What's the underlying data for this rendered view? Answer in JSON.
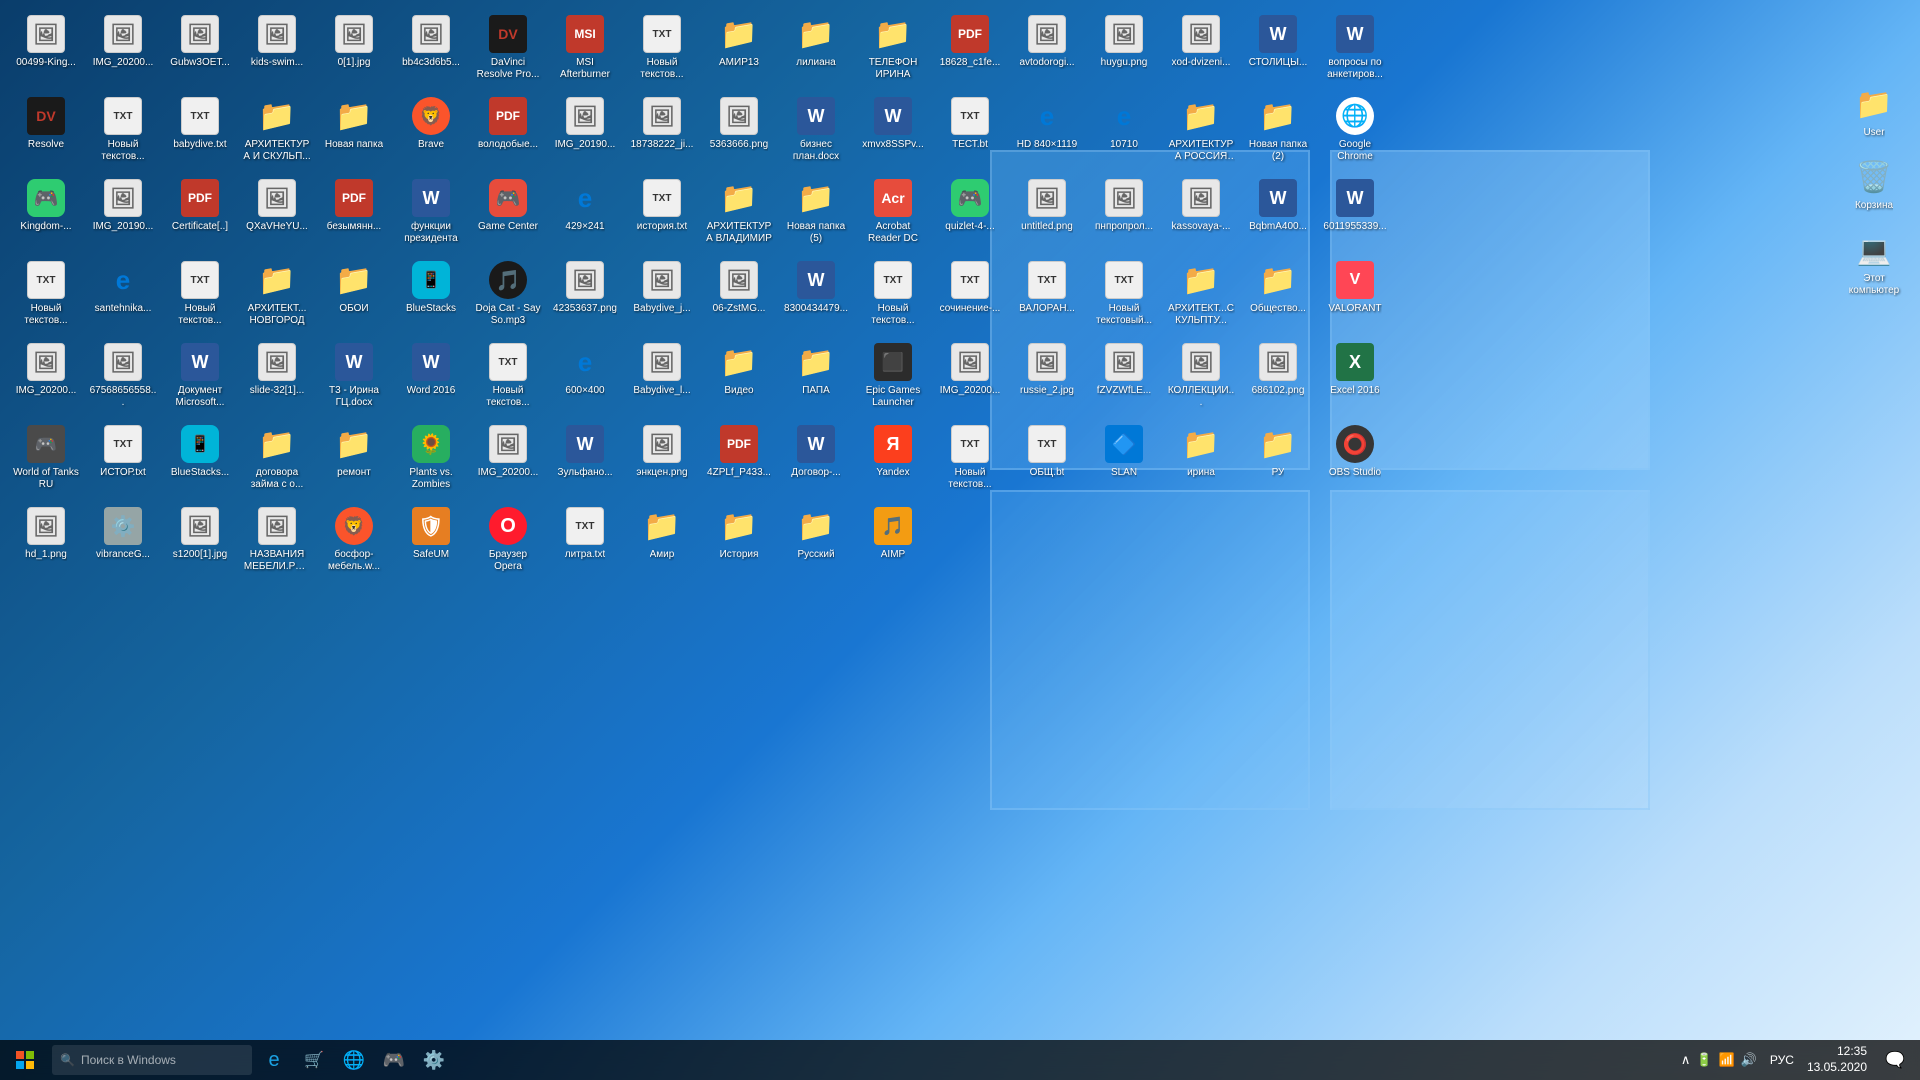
{
  "desktop": {
    "icons": [
      {
        "id": "00499-King",
        "label": "00499-King...",
        "type": "image",
        "emoji": "🖼️"
      },
      {
        "id": "IMG_20200",
        "label": "IMG_20200...",
        "type": "image",
        "emoji": "🖼️"
      },
      {
        "id": "Gubw3OET",
        "label": "Gubw3OET...",
        "type": "image",
        "emoji": "🖼️"
      },
      {
        "id": "kids-swim",
        "label": "kids-swim...",
        "type": "image",
        "emoji": "🖼️"
      },
      {
        "id": "0l1jpg",
        "label": "0[1].jpg",
        "type": "image",
        "emoji": "🖼️"
      },
      {
        "id": "bb4c3d6b5",
        "label": "bb4c3d6b5...",
        "type": "image",
        "emoji": "🖼️"
      },
      {
        "id": "DaVinci",
        "label": "DaVinci Resolve Pro...",
        "type": "app",
        "emoji": "🎬",
        "color": "#1a1a1a"
      },
      {
        "id": "MSI-Afterburner",
        "label": "MSI Afterburner",
        "type": "app",
        "emoji": "🔥",
        "color": "#c0392b"
      },
      {
        "id": "Noviy-txt1",
        "label": "Новый текстов...",
        "type": "text",
        "emoji": "📄"
      },
      {
        "id": "AMIR13",
        "label": "АМИР13",
        "type": "folder",
        "emoji": "📁"
      },
      {
        "id": "liliana",
        "label": "лилиана",
        "type": "folder",
        "emoji": "📁"
      },
      {
        "id": "TELEFON-IRINA",
        "label": "ТЕЛЕФОН ИРИНА",
        "type": "folder",
        "emoji": "📁"
      },
      {
        "id": "18628-c1fe",
        "label": "18628_c1fe...",
        "type": "pdf",
        "emoji": "PDF"
      },
      {
        "id": "avtodorogi",
        "label": "avtodorogi...",
        "type": "image",
        "emoji": "🖼️"
      },
      {
        "id": "huygu-png",
        "label": "huygu.png",
        "type": "image",
        "emoji": "🖼️"
      },
      {
        "id": "xod-dvizeni",
        "label": "xod-dvizeni...",
        "type": "image",
        "emoji": "🖼️"
      },
      {
        "id": "STOLICY",
        "label": "СТОЛИЦЫ...",
        "type": "word",
        "emoji": "W"
      },
      {
        "id": "voprosy-anket",
        "label": "вопросы по анкетиров...",
        "type": "word",
        "emoji": "W"
      },
      {
        "id": "Resolve",
        "label": "Resolve",
        "type": "app",
        "emoji": "🎬",
        "color": "#1a1a1a"
      },
      {
        "id": "Noviy-txt2",
        "label": "Новый текстов...",
        "type": "text",
        "emoji": "📄"
      },
      {
        "id": "babydive-txt",
        "label": "babydive.txt",
        "type": "text",
        "emoji": "📄"
      },
      {
        "id": "ARHITEKTURA-SKULP",
        "label": "АРХИТЕКТУРА И СКУЛЬП...",
        "type": "folder",
        "emoji": "📁"
      },
      {
        "id": "Novaya-papka",
        "label": "Новая папка",
        "type": "folder",
        "emoji": "📁"
      },
      {
        "id": "Brave",
        "label": "Brave",
        "type": "app",
        "emoji": "🦁",
        "color": "#fb542b"
      },
      {
        "id": "volodobye",
        "label": "володобые...",
        "type": "pdf",
        "emoji": "PDF"
      },
      {
        "id": "IMG-201900",
        "label": "IMG_20190...",
        "type": "image",
        "emoji": "🖼️"
      },
      {
        "id": "18738222-ji",
        "label": "18738222_ji...",
        "type": "image",
        "emoji": "🖼️"
      },
      {
        "id": "5363666-png",
        "label": "5363666.png",
        "type": "image",
        "emoji": "🖼️"
      },
      {
        "id": "biznes-plan",
        "label": "бизнес план.docx",
        "type": "word",
        "emoji": "W"
      },
      {
        "id": "xmvx8SSPv",
        "label": "xmvx8SSPv...",
        "type": "word",
        "emoji": "W"
      },
      {
        "id": "TEST-txt",
        "label": "ТЕСТ.bt",
        "type": "text",
        "emoji": "📄"
      },
      {
        "id": "HD840x1119",
        "label": "HD 840×1119",
        "type": "app",
        "emoji": "🌐",
        "color": "#0078d7"
      },
      {
        "id": "10710",
        "label": "10710",
        "type": "app",
        "emoji": "🌐",
        "color": "#0078d7"
      },
      {
        "id": "ARHITEKTURA-ROSSIYA",
        "label": "АРХИТЕКТУРА РОССИЯ И...",
        "type": "folder",
        "emoji": "📁"
      },
      {
        "id": "Novaya-papka2",
        "label": "Новая папка (2)",
        "type": "folder",
        "emoji": "📁"
      },
      {
        "id": "Google-Chrome",
        "label": "Google Chrome",
        "type": "app",
        "emoji": "🌐",
        "color": "#4285f4"
      },
      {
        "id": "Kingdom",
        "label": "Kingdom-...",
        "type": "app",
        "emoji": "🎮",
        "color": "#2ecc71"
      },
      {
        "id": "IMG-201901",
        "label": "IMG_20190...",
        "type": "image",
        "emoji": "🖼️"
      },
      {
        "id": "Certificate",
        "label": "Certificate[..]",
        "type": "pdf",
        "emoji": "PDF"
      },
      {
        "id": "QXaVHeYU",
        "label": "QXaVHeYU...",
        "type": "image",
        "emoji": "🖼️"
      },
      {
        "id": "bezymyann",
        "label": "безымянн...",
        "type": "pdf",
        "emoji": "PDF"
      },
      {
        "id": "funktsii-prezidenta",
        "label": "функции президента",
        "type": "word",
        "emoji": "W"
      },
      {
        "id": "GameCenter",
        "label": "Game Center",
        "type": "app",
        "emoji": "🎮",
        "color": "#e74c3c"
      },
      {
        "id": "429x241",
        "label": "429×241",
        "type": "app",
        "emoji": "🌐",
        "color": "#0078d7"
      },
      {
        "id": "istoriya-txt",
        "label": "история.txt",
        "type": "text",
        "emoji": "📄"
      },
      {
        "id": "ARHITEKTURA-VLADIMIR",
        "label": "АРХИТЕКТУРА ВЛАДИМИР",
        "type": "folder",
        "emoji": "📁"
      },
      {
        "id": "Novaya-papka5",
        "label": "Новая папка (5)",
        "type": "folder",
        "emoji": "📁"
      },
      {
        "id": "Acrobat-DC",
        "label": "Acrobat Reader DC",
        "type": "app",
        "emoji": "📕",
        "color": "#e74c3c"
      },
      {
        "id": "quizlet-4",
        "label": "quizlet-4-...",
        "type": "app",
        "emoji": "🎮",
        "color": "#4a90e2"
      },
      {
        "id": "untitled-png",
        "label": "untitled.png",
        "type": "image",
        "emoji": "🖼️"
      },
      {
        "id": "pnproprol",
        "label": "пнпропрол...",
        "type": "image",
        "emoji": "🖼️"
      },
      {
        "id": "kassovaya",
        "label": "kassovaya-...",
        "type": "image",
        "emoji": "🖼️"
      },
      {
        "id": "BqbmA400",
        "label": "BqbmA400...",
        "type": "word",
        "emoji": "W"
      },
      {
        "id": "6011955339",
        "label": "6011955339...",
        "type": "word",
        "emoji": "W"
      },
      {
        "id": "Noviy-txt3",
        "label": "Новый текстов...",
        "type": "text",
        "emoji": "📄"
      },
      {
        "id": "santehnika",
        "label": "santehnika...",
        "type": "app",
        "emoji": "🌐",
        "color": "#0078d7"
      },
      {
        "id": "Noviy-txt4",
        "label": "Новый текстов...",
        "type": "text",
        "emoji": "📄"
      },
      {
        "id": "ARHITEKTURA-NOVGOROD",
        "label": "АРХИТЕКТ... НОВГОРОД",
        "type": "folder",
        "emoji": "📁"
      },
      {
        "id": "OBOI",
        "label": "ОБОИ",
        "type": "folder",
        "emoji": "📁"
      },
      {
        "id": "BlueStacks",
        "label": "BlueStacks",
        "type": "app",
        "emoji": "📱",
        "color": "#00b4d8"
      },
      {
        "id": "DojaCat",
        "label": "Doja Cat - Say So.mp3",
        "type": "mp3",
        "emoji": "🎵"
      },
      {
        "id": "42353637",
        "label": "42353637.png",
        "type": "image",
        "emoji": "🖼️"
      },
      {
        "id": "Babydive-jpg",
        "label": "Babydive_j...",
        "type": "image",
        "emoji": "🖼️"
      },
      {
        "id": "06-ZstMG",
        "label": "06-ZstMG...",
        "type": "image",
        "emoji": "🖼️"
      },
      {
        "id": "8300434",
        "label": "8300434479...",
        "type": "word",
        "emoji": "W"
      },
      {
        "id": "Noviy-txt5",
        "label": "Новый текстов...",
        "type": "text",
        "emoji": "📄"
      },
      {
        "id": "sochinenie",
        "label": "сочинение-...",
        "type": "text",
        "emoji": "📄"
      },
      {
        "id": "VALORAN",
        "label": "ВАЛОРАН...",
        "type": "text",
        "emoji": "📄"
      },
      {
        "id": "Noviy-txt6",
        "label": "Новый текстовый...",
        "type": "text",
        "emoji": "📄"
      },
      {
        "id": "ARHITEKTURA-SCULP",
        "label": "АРХИТЕКТ...СКУЛЬПТУ...",
        "type": "folder",
        "emoji": "📁"
      },
      {
        "id": "Obschestvo",
        "label": "Общество...",
        "type": "folder",
        "emoji": "📁"
      },
      {
        "id": "VALORANT",
        "label": "VALORANT",
        "type": "app",
        "emoji": "V",
        "color": "#ff4655"
      },
      {
        "id": "IMG-202000",
        "label": "IMG_20200...",
        "type": "image",
        "emoji": "🖼️"
      },
      {
        "id": "67568656",
        "label": "67568656558...",
        "type": "image",
        "emoji": "🖼️"
      },
      {
        "id": "Dokument-MS",
        "label": "Документ Microsoft...",
        "type": "word",
        "emoji": "W"
      },
      {
        "id": "slide-32",
        "label": "slide-32[1]...",
        "type": "image",
        "emoji": "🖼️"
      },
      {
        "id": "T3-Irina",
        "label": "Т3 - Ирина ГЦ.docx",
        "type": "word",
        "emoji": "W"
      },
      {
        "id": "Word2016",
        "label": "Word 2016",
        "type": "app",
        "emoji": "W",
        "color": "#2980b9"
      },
      {
        "id": "Noviy-txt7",
        "label": "Новый текстов...",
        "type": "text",
        "emoji": "📄"
      },
      {
        "id": "600x400",
        "label": "600×400",
        "type": "app",
        "emoji": "🌐",
        "color": "#0078d7"
      },
      {
        "id": "Babydive-l",
        "label": "Babydive_l...",
        "type": "image",
        "emoji": "🖼️"
      },
      {
        "id": "Video",
        "label": "Видео",
        "type": "folder",
        "emoji": "📁"
      },
      {
        "id": "PAPA",
        "label": "ПАПА",
        "type": "folder",
        "emoji": "📁"
      },
      {
        "id": "EpicGames",
        "label": "Epic Games Launcher",
        "type": "app",
        "emoji": "⬛",
        "color": "#2c2c2c"
      },
      {
        "id": "IMG-202001",
        "label": "IMG_20200...",
        "type": "image",
        "emoji": "🖼️"
      },
      {
        "id": "russie-2",
        "label": "russie_2.jpg",
        "type": "image",
        "emoji": "🖼️"
      },
      {
        "id": "fZVZWfLE",
        "label": "fZVZWfLE...",
        "type": "image",
        "emoji": "🖼️"
      },
      {
        "id": "KOLLEKCII",
        "label": "КОЛЛЕКЦИИ...",
        "type": "image",
        "emoji": "🖼️"
      },
      {
        "id": "686102",
        "label": "686102.png",
        "type": "image",
        "emoji": "🖼️"
      },
      {
        "id": "Excel2016",
        "label": "Excel 2016",
        "type": "app",
        "emoji": "X",
        "color": "#27ae60"
      },
      {
        "id": "WorldOfTanks",
        "label": "World of Tanks RU",
        "type": "app",
        "emoji": "🎮",
        "color": "#4a4a4a"
      },
      {
        "id": "ISTOR-txt",
        "label": "ИСТОР.txt",
        "type": "text",
        "emoji": "📄"
      },
      {
        "id": "BlueStacks2",
        "label": "BlueStacks...",
        "type": "app",
        "emoji": "📱",
        "color": "#00b4d8"
      },
      {
        "id": "dogovor-zayma",
        "label": "договора займа с о...",
        "type": "folder",
        "emoji": "📁"
      },
      {
        "id": "remont",
        "label": "ремонт",
        "type": "folder",
        "emoji": "📁"
      },
      {
        "id": "PlantsVsZombies",
        "label": "Plants vs. Zombies",
        "type": "app",
        "emoji": "🌻",
        "color": "#27ae60"
      },
      {
        "id": "IMG-202002",
        "label": "IMG_20200...",
        "type": "image",
        "emoji": "🖼️"
      },
      {
        "id": "Zulfano",
        "label": "Зульфано...",
        "type": "word",
        "emoji": "W"
      },
      {
        "id": "enkcen-png",
        "label": "энкцен.png",
        "type": "image",
        "emoji": "🖼️"
      },
      {
        "id": "4ZPLf-P433",
        "label": "4ZPLf_P433...",
        "type": "pdf",
        "emoji": "PDF"
      },
      {
        "id": "Dogovor",
        "label": "Договор-...",
        "type": "word",
        "emoji": "W"
      },
      {
        "id": "Yandex",
        "label": "Yandex",
        "type": "app",
        "emoji": "Я",
        "color": "#f00"
      },
      {
        "id": "Noviy-txt8",
        "label": "Новый текстов...",
        "type": "text",
        "emoji": "📄"
      },
      {
        "id": "OBSH-txt",
        "label": "ОБЩ.bt",
        "type": "text",
        "emoji": "📄"
      },
      {
        "id": "SLAN",
        "label": "SLAN",
        "type": "app",
        "emoji": "🔷"
      },
      {
        "id": "irina",
        "label": "ирина",
        "type": "folder",
        "emoji": "📁"
      },
      {
        "id": "RU",
        "label": "РУ",
        "type": "folder",
        "emoji": "📁"
      },
      {
        "id": "OBSStudio",
        "label": "OBS Studio",
        "type": "app",
        "emoji": "⭕",
        "color": "#363636"
      },
      {
        "id": "hd-1",
        "label": "hd_1.png",
        "type": "image",
        "emoji": "🖼️"
      },
      {
        "id": "vibranceG",
        "label": "vibranceG...",
        "type": "app",
        "emoji": "⚙️"
      },
      {
        "id": "s1200",
        "label": "s1200[1].jpg",
        "type": "image",
        "emoji": "🖼️"
      },
      {
        "id": "NAZVANIYA-ROSSII",
        "label": "НАЗВАНИЯ МЕБЕЛИ.РОС...",
        "type": "image",
        "emoji": "🖼️"
      },
      {
        "id": "bosforus",
        "label": "босфор-мебель.w...",
        "type": "app",
        "emoji": "🦁",
        "color": "#fb542b"
      },
      {
        "id": "SafeUM",
        "label": "SafeUM",
        "type": "app",
        "emoji": "🛡️",
        "color": "#e67e22"
      },
      {
        "id": "Brauser-Opera",
        "label": "Браузер Opera",
        "type": "app",
        "emoji": "O",
        "color": "#ff1b2d"
      },
      {
        "id": "litra-txt",
        "label": "литра.txt",
        "type": "text",
        "emoji": "📄"
      },
      {
        "id": "Amir",
        "label": "Амир",
        "type": "folder",
        "emoji": "📁"
      },
      {
        "id": "Istoriya",
        "label": "История",
        "type": "folder",
        "emoji": "📁"
      },
      {
        "id": "Russkiy",
        "label": "Русский",
        "type": "folder",
        "emoji": "📁"
      },
      {
        "id": "AIMP",
        "label": "AIMP",
        "type": "app",
        "emoji": "🎵",
        "color": "#f39c12"
      }
    ],
    "right_icons": [
      {
        "id": "User",
        "label": "User",
        "type": "folder",
        "emoji": "👤"
      },
      {
        "id": "Korzina",
        "label": "Корзина",
        "type": "trash",
        "emoji": "🗑️"
      },
      {
        "id": "EtotKomputer",
        "label": "Этот компьютер",
        "type": "computer",
        "emoji": "💻"
      }
    ]
  },
  "taskbar": {
    "start_label": "⊞",
    "search_placeholder": "Поиск в Windows",
    "lang": "РУС",
    "time": "12:35",
    "date": "13.05.2020",
    "taskbar_icons": [
      "🌐",
      "🎮",
      "💬"
    ],
    "sys_icons": [
      "🔔",
      "🔊",
      "📶"
    ]
  }
}
